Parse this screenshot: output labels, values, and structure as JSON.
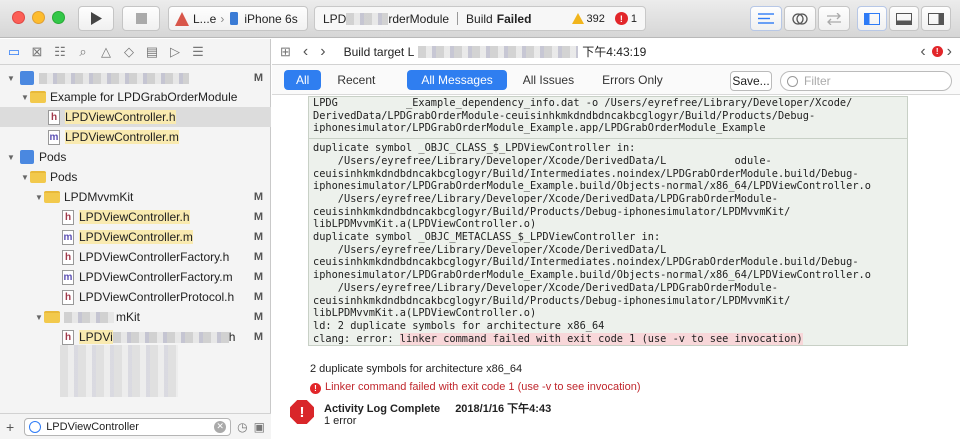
{
  "toolbar": {
    "scheme_target": "L...e",
    "device": "iPhone 6s",
    "status_project": "LPD",
    "status_project_tail": "rderModule",
    "build_prefix": "Build",
    "build_state": "Failed",
    "warning_count": "392",
    "error_count": "1"
  },
  "navigator": {
    "rows": [
      {
        "label": "",
        "mark": "M"
      },
      {
        "label": "Example for LPDGrabOrderModule"
      },
      {
        "label": "LPDViewController.h"
      },
      {
        "label": "LPDViewController.m"
      },
      {
        "label": "Pods"
      },
      {
        "label": "Pods"
      },
      {
        "label": "LPDMvvmKit",
        "mark": "M"
      },
      {
        "label": "LPDViewController.h",
        "mark": "M"
      },
      {
        "label": "LPDViewController.m",
        "mark": "M"
      },
      {
        "label": "LPDViewControllerFactory.h",
        "mark": "M"
      },
      {
        "label": "LPDViewControllerFactory.m",
        "mark": "M"
      },
      {
        "label": "LPDViewControllerProtocol.h",
        "mark": "M"
      },
      {
        "label": "mKit",
        "mark": "M"
      },
      {
        "label": "LPDVi",
        "tail": "h",
        "mark": "M"
      }
    ],
    "filter_value": "LPDViewController"
  },
  "editor": {
    "jump_bar_text": "Build target L",
    "jump_bar_time": "下午4:43:19",
    "tabs": {
      "all": "All",
      "recent": "Recent",
      "all_messages": "All Messages",
      "all_issues": "All Issues",
      "errors_only": "Errors Only"
    },
    "save_label": "Save...",
    "filter_placeholder": "Filter",
    "log_block_1": "LPDG           _Example_dependency_info.dat -o /Users/eyrefree/Library/Developer/Xcode/\nDerivedData/LPDGrabOrderModule-ceuisinhkmkdndbdncakbcglogyr/Build/Products/Debug-\niphonesimulator/LPDGrabOrderModule_Example.app/LPDGrabOrderModule_Example",
    "log_block_2": "duplicate symbol _OBJC_CLASS_$_LPDViewController in:\n    /Users/eyrefree/Library/Developer/Xcode/DerivedData/L           odule-\nceuisinhkmkdndbdncakbcglogyr/Build/Intermediates.noindex/LPDGrabOrderModule.build/Debug-\niphonesimulator/LPDGrabOrderModule_Example.build/Objects-normal/x86_64/LPDViewController.o\n    /Users/eyrefree/Library/Developer/Xcode/DerivedData/LPDGrabOrderModule-\nceuisinhkmkdndbdncakbcglogyr/Build/Products/Debug-iphonesimulator/LPDMvvmKit/\nlibLPDMvvmKit.a(LPDViewController.o)\nduplicate symbol _OBJC_METACLASS_$_LPDViewController in:\n    /Users/eyrefree/Library/Developer/Xcode/DerivedData/L           \nceuisinhkmkdndbdncakbcglogyr/Build/Intermediates.noindex/LPDGrabOrderModule.build/Debug-\niphonesimulator/LPDGrabOrderModule_Example.build/Objects-normal/x86_64/LPDViewController.o\n    /Users/eyrefree/Library/Developer/Xcode/DerivedData/LPDGrabOrderModule-\nceuisinhkmkdndbdncakbcglogyr/Build/Products/Debug-iphonesimulator/LPDMvvmKit/\nlibLPDMvvmKit.a(LPDViewController.o)\nld: 2 duplicate symbols for architecture x86_64",
    "log_error_prefix": "clang: error: ",
    "log_error_text": "linker command failed with exit code 1 (use -v to see invocation)",
    "summary_dup": "2 duplicate symbols for architecture x86_64",
    "summary_linker": "Linker command failed with exit code 1 (use -v to see invocation)",
    "activity_title": "Activity Log Complete",
    "activity_time": "2018/1/16 下午4:43",
    "activity_errors": "1 error"
  },
  "colors": {
    "accent": "#2f7ef0",
    "error": "#d9262a",
    "warning": "#f1b51c",
    "log_bg": "#edf1ec"
  }
}
